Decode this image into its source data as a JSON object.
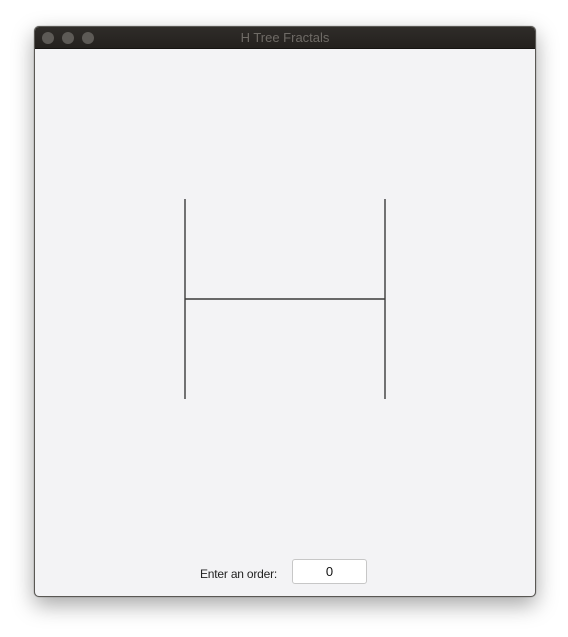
{
  "window": {
    "title": "H Tree Fractals",
    "buttons": [
      "close",
      "minimize",
      "maximize"
    ]
  },
  "canvas": {
    "order": 0,
    "line_color": "#3a3a3a"
  },
  "controls": {
    "order_label": "Enter an order:",
    "order_value": "0"
  },
  "colors": {
    "window_background": "#f3f3f5",
    "titlebar": "#24211e",
    "title_text": "#6f6b66"
  }
}
